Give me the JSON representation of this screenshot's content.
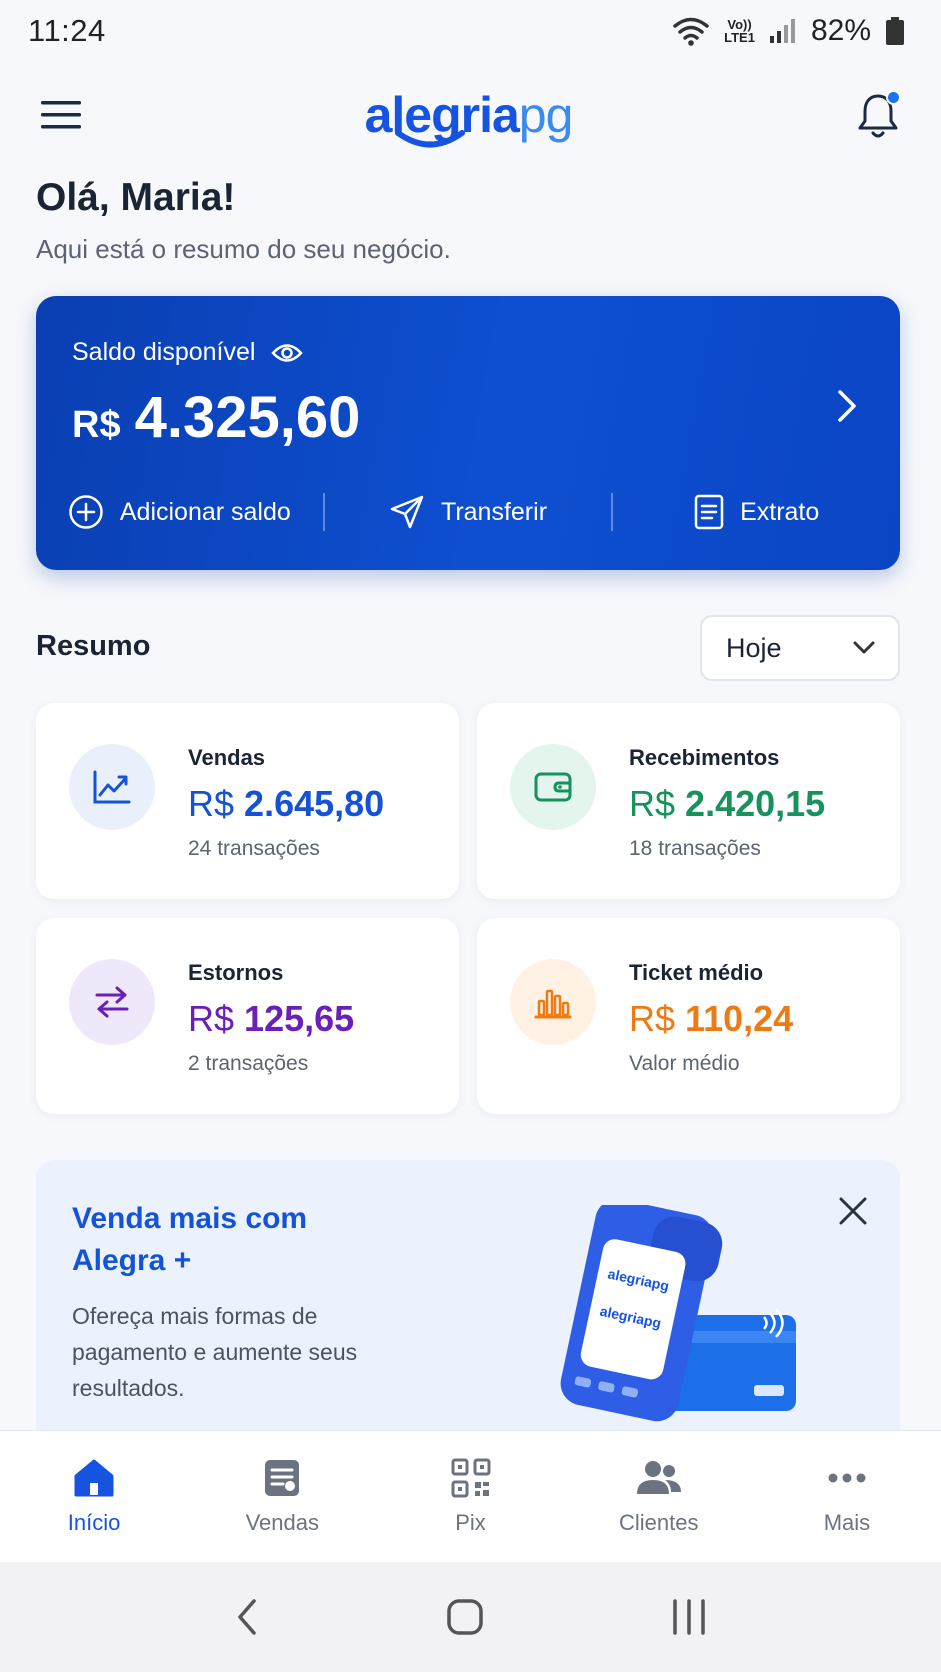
{
  "status_bar": {
    "time": "11:24",
    "network_top": "Vo))",
    "network_bottom": "LTE1",
    "battery": "82%"
  },
  "header": {
    "logo_part1": "alegria",
    "logo_part2": "pg"
  },
  "greeting": {
    "title": "Olá, Maria!",
    "subtitle": "Aqui está o resumo do seu negócio."
  },
  "balance": {
    "label": "Saldo disponível",
    "currency": "R$",
    "amount": "4.325,60",
    "actions": {
      "add": "Adicionar saldo",
      "transfer": "Transferir",
      "statement": "Extrato"
    }
  },
  "summary": {
    "title": "Resumo",
    "period": "Hoje",
    "cards": [
      {
        "label": "Vendas",
        "currency": "R$",
        "value": "2.645,80",
        "sub": "24 transações",
        "color": "#1553d6",
        "icon_bg": "#e9f0fc"
      },
      {
        "label": "Recebimentos",
        "currency": "R$",
        "value": "2.420,15",
        "sub": "18 transações",
        "color": "#16925c",
        "icon_bg": "#e3f5ec"
      },
      {
        "label": "Estornos",
        "currency": "R$",
        "value": "125,65",
        "sub": "2 transações",
        "color": "#6a1fb8",
        "icon_bg": "#efe8fa"
      },
      {
        "label": "Ticket médio",
        "currency": "R$",
        "value": "110,24",
        "sub": "Valor médio",
        "color": "#ee7a14",
        "icon_bg": "#fff1e3"
      }
    ]
  },
  "promo": {
    "title": "Venda mais com Alegra +",
    "text": "Ofereça mais formas de pagamento e aumente seus resultados.",
    "device_logo": "alegriapg"
  },
  "bottom_nav": [
    {
      "label": "Início",
      "icon": "home-icon",
      "active": true
    },
    {
      "label": "Vendas",
      "icon": "receipt-icon",
      "active": false
    },
    {
      "label": "Pix",
      "icon": "qr-code-icon",
      "active": false
    },
    {
      "label": "Clientes",
      "icon": "people-icon",
      "active": false
    },
    {
      "label": "Mais",
      "icon": "more-icon",
      "active": false
    }
  ],
  "colors": {
    "primary": "#1553e0",
    "card_blue": "#0e4fd1",
    "notification_dot": "#1a73f0"
  }
}
